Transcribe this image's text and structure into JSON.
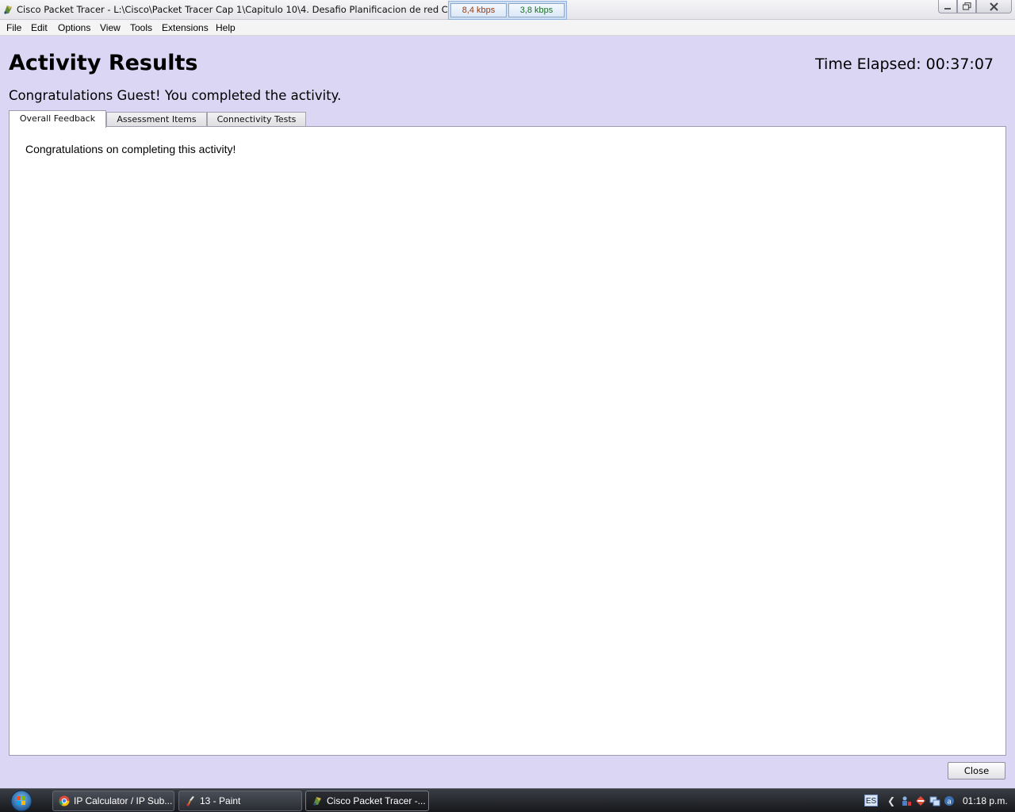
{
  "window": {
    "title": "Cisco Packet Tracer - L:\\Cisco\\Packet Tracer Cap 1\\Capitulo 10\\4. Desafio Planificacion de red Configur",
    "download_speed": "8,4 kbps",
    "upload_speed": "3,8 kbps"
  },
  "menu": {
    "items": [
      "File",
      "Edit",
      "Options",
      "View",
      "Tools",
      "Extensions",
      "Help"
    ]
  },
  "results": {
    "heading": "Activity Results",
    "time_label": "Time Elapsed:",
    "time_value": "00:37:07",
    "congrats": "Congratulations Guest! You completed the activity.",
    "tabs": [
      "Overall Feedback",
      "Assessment Items",
      "Connectivity Tests"
    ],
    "active_tab": "Overall Feedback",
    "feedback": "Congratulations on completing this activity!",
    "close_label": "Close"
  },
  "taskbar": {
    "tasks": [
      "IP Calculator / IP Sub...",
      "13 - Paint",
      "Cisco Packet Tracer -..."
    ],
    "active_task": "Cisco Packet Tracer -...",
    "language": "ES",
    "clock": "01:18 p.m."
  },
  "colors": {
    "background": "#dad6f4",
    "panel": "#ffffff"
  }
}
